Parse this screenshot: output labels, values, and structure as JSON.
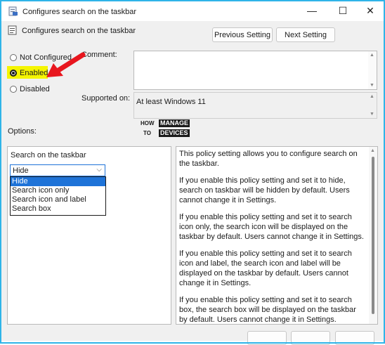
{
  "window": {
    "title": "Configures search on the taskbar",
    "minimize_glyph": "—",
    "maximize_glyph": "☐",
    "close_glyph": "✕"
  },
  "header": {
    "policy_title": "Configures search on the taskbar",
    "prev_label": "Previous Setting",
    "next_label": "Next Setting"
  },
  "state": {
    "not_configured": "Not Configured",
    "enabled": "Enabled",
    "disabled": "Disabled",
    "selected": "enabled"
  },
  "comment_label": "Comment:",
  "supported_label": "Supported on:",
  "supported_value": "At least Windows 11",
  "watermark": {
    "line1a": "HOW",
    "line1b": "MANAGE",
    "line2a": "TO",
    "line2b": "DEVICES"
  },
  "options_label": "Options:",
  "search_setting": {
    "label": "Search on the taskbar",
    "selected": "Hide",
    "options": [
      "Hide",
      "Search icon only",
      "Search icon and label",
      "Search box"
    ]
  },
  "help": {
    "p1": "This policy setting allows you to configure search on the taskbar.",
    "p2": "If you enable this policy setting and set it to hide, search on taskbar will be hidden by default. Users cannot change it in Settings.",
    "p3": "If you enable this policy setting and set it to search icon only, the search icon will be displayed on the taskbar by default. Users cannot change it in Settings.",
    "p4": "If you enable this policy setting and set it to search icon and label, the search icon and label will be displayed on the taskbar by default. Users cannot change it in Settings.",
    "p5": "If you enable this policy setting and set it to search box, the search box will be displayed on the taskbar by default. Users cannot change it in Settings."
  },
  "colors": {
    "frame": "#2fb4e8",
    "highlight": "#f5f500",
    "arrow": "#e8161e",
    "selection": "#1e73d8"
  }
}
